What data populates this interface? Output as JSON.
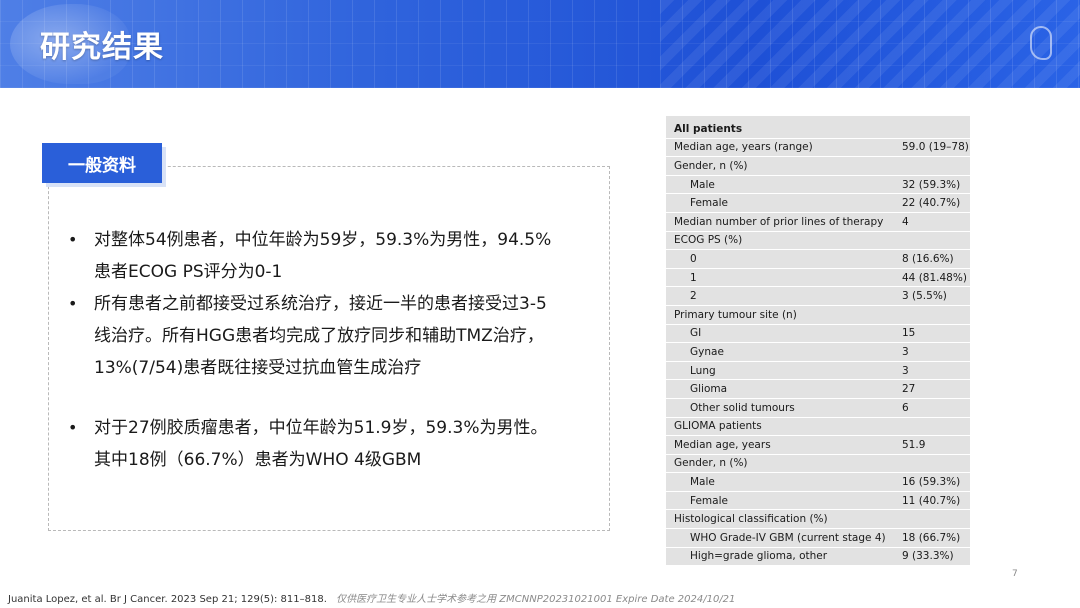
{
  "header": {
    "title": "研究结果"
  },
  "tag": {
    "label": "一般资料"
  },
  "bullets": [
    {
      "line1": "对整体54例患者，中位年龄为59岁，59.3%为男性，94.5%",
      "line2": "患者ECOG PS评分为0-1"
    },
    {
      "line1": "所有患者之前都接受过系统治疗，接近一半的患者接受过3-5",
      "line2": "线治疗。所有HGG患者均完成了放疗同步和辅助TMZ治疗，",
      "line3": "13%(7/54)患者既往接受过抗血管生成治疗"
    },
    {
      "line1": "对于27例胶质瘤患者，中位年龄为51.9岁，59.3%为男性。",
      "line2": "其中18例（66.7%）患者为WHO 4级GBM"
    }
  ],
  "table": {
    "rows": [
      {
        "label": "All patients",
        "value": "",
        "style": "bold"
      },
      {
        "label": "Median age, years (range)",
        "value": "59.0 (19–78)",
        "style": ""
      },
      {
        "label": "Gender, n (%)",
        "value": "",
        "style": ""
      },
      {
        "label": "Male",
        "value": "32 (59.3%)",
        "style": "sub"
      },
      {
        "label": "Female",
        "value": "22 (40.7%)",
        "style": "sub"
      },
      {
        "label": "Median number of prior lines of therapy",
        "value": "4",
        "style": ""
      },
      {
        "label": "ECOG PS (%)",
        "value": "",
        "style": ""
      },
      {
        "label": "0",
        "value": "8 (16.6%)",
        "style": "sub"
      },
      {
        "label": "1",
        "value": "44 (81.48%)",
        "style": "sub"
      },
      {
        "label": "2",
        "value": "3 (5.5%)",
        "style": "sub"
      },
      {
        "label": "Primary tumour site (n)",
        "value": "",
        "style": ""
      },
      {
        "label": "GI",
        "value": "15",
        "style": "sub"
      },
      {
        "label": "Gynae",
        "value": "3",
        "style": "sub"
      },
      {
        "label": "Lung",
        "value": "3",
        "style": "sub"
      },
      {
        "label": "Glioma",
        "value": "27",
        "style": "sub"
      },
      {
        "label": "Other solid tumours",
        "value": "6",
        "style": "sub"
      },
      {
        "label": "GLIOMA patients",
        "value": "",
        "style": ""
      },
      {
        "label": "Median age, years",
        "value": "51.9",
        "style": ""
      },
      {
        "label": "Gender, n (%)",
        "value": "",
        "style": ""
      },
      {
        "label": "Male",
        "value": "16 (59.3%)",
        "style": "sub"
      },
      {
        "label": "Female",
        "value": "11 (40.7%)",
        "style": "sub"
      },
      {
        "label": "Histological classification (%)",
        "value": "",
        "style": ""
      },
      {
        "label": "WHO Grade-IV GBM (current stage 4)",
        "value": "18 (66.7%)",
        "style": "sub"
      },
      {
        "label": "High=grade glioma, other",
        "value": "9 (33.3%)",
        "style": "sub"
      }
    ]
  },
  "page_number": "7",
  "footer": {
    "citation": "Juanita Lopez, et al. Br J Cancer. 2023 Sep 21; 129(5): 811–818.",
    "note": "仅供医疗卫生专业人士学术参考之用 ZMCNNP20231021001 Expire Date 2024/10/21"
  }
}
